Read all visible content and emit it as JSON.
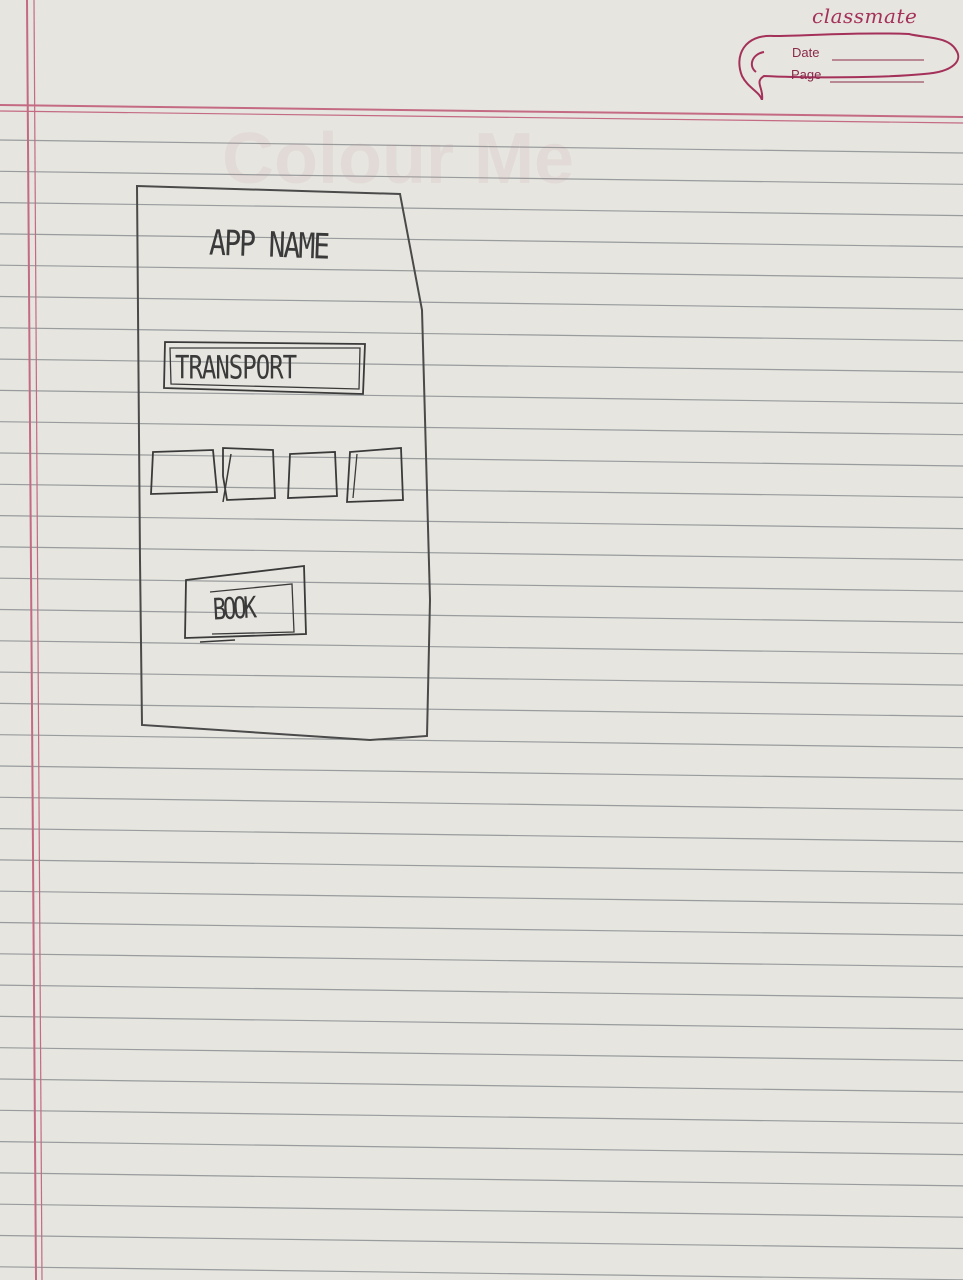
{
  "notebook": {
    "brand": "classmate",
    "date_label": "Date",
    "page_label": "Page",
    "watermark": "Colour Me"
  },
  "wireframe": {
    "app_name": "APP NAME",
    "transport_label": "TRANSPORT",
    "option_boxes": 4,
    "book_label": "BOOK"
  },
  "colors": {
    "paper": "#e6e5df",
    "ruled_line": "#7e8488",
    "margin_line": "#c46a83",
    "brand": "#a4315a",
    "pencil": "#3a3a3a"
  }
}
